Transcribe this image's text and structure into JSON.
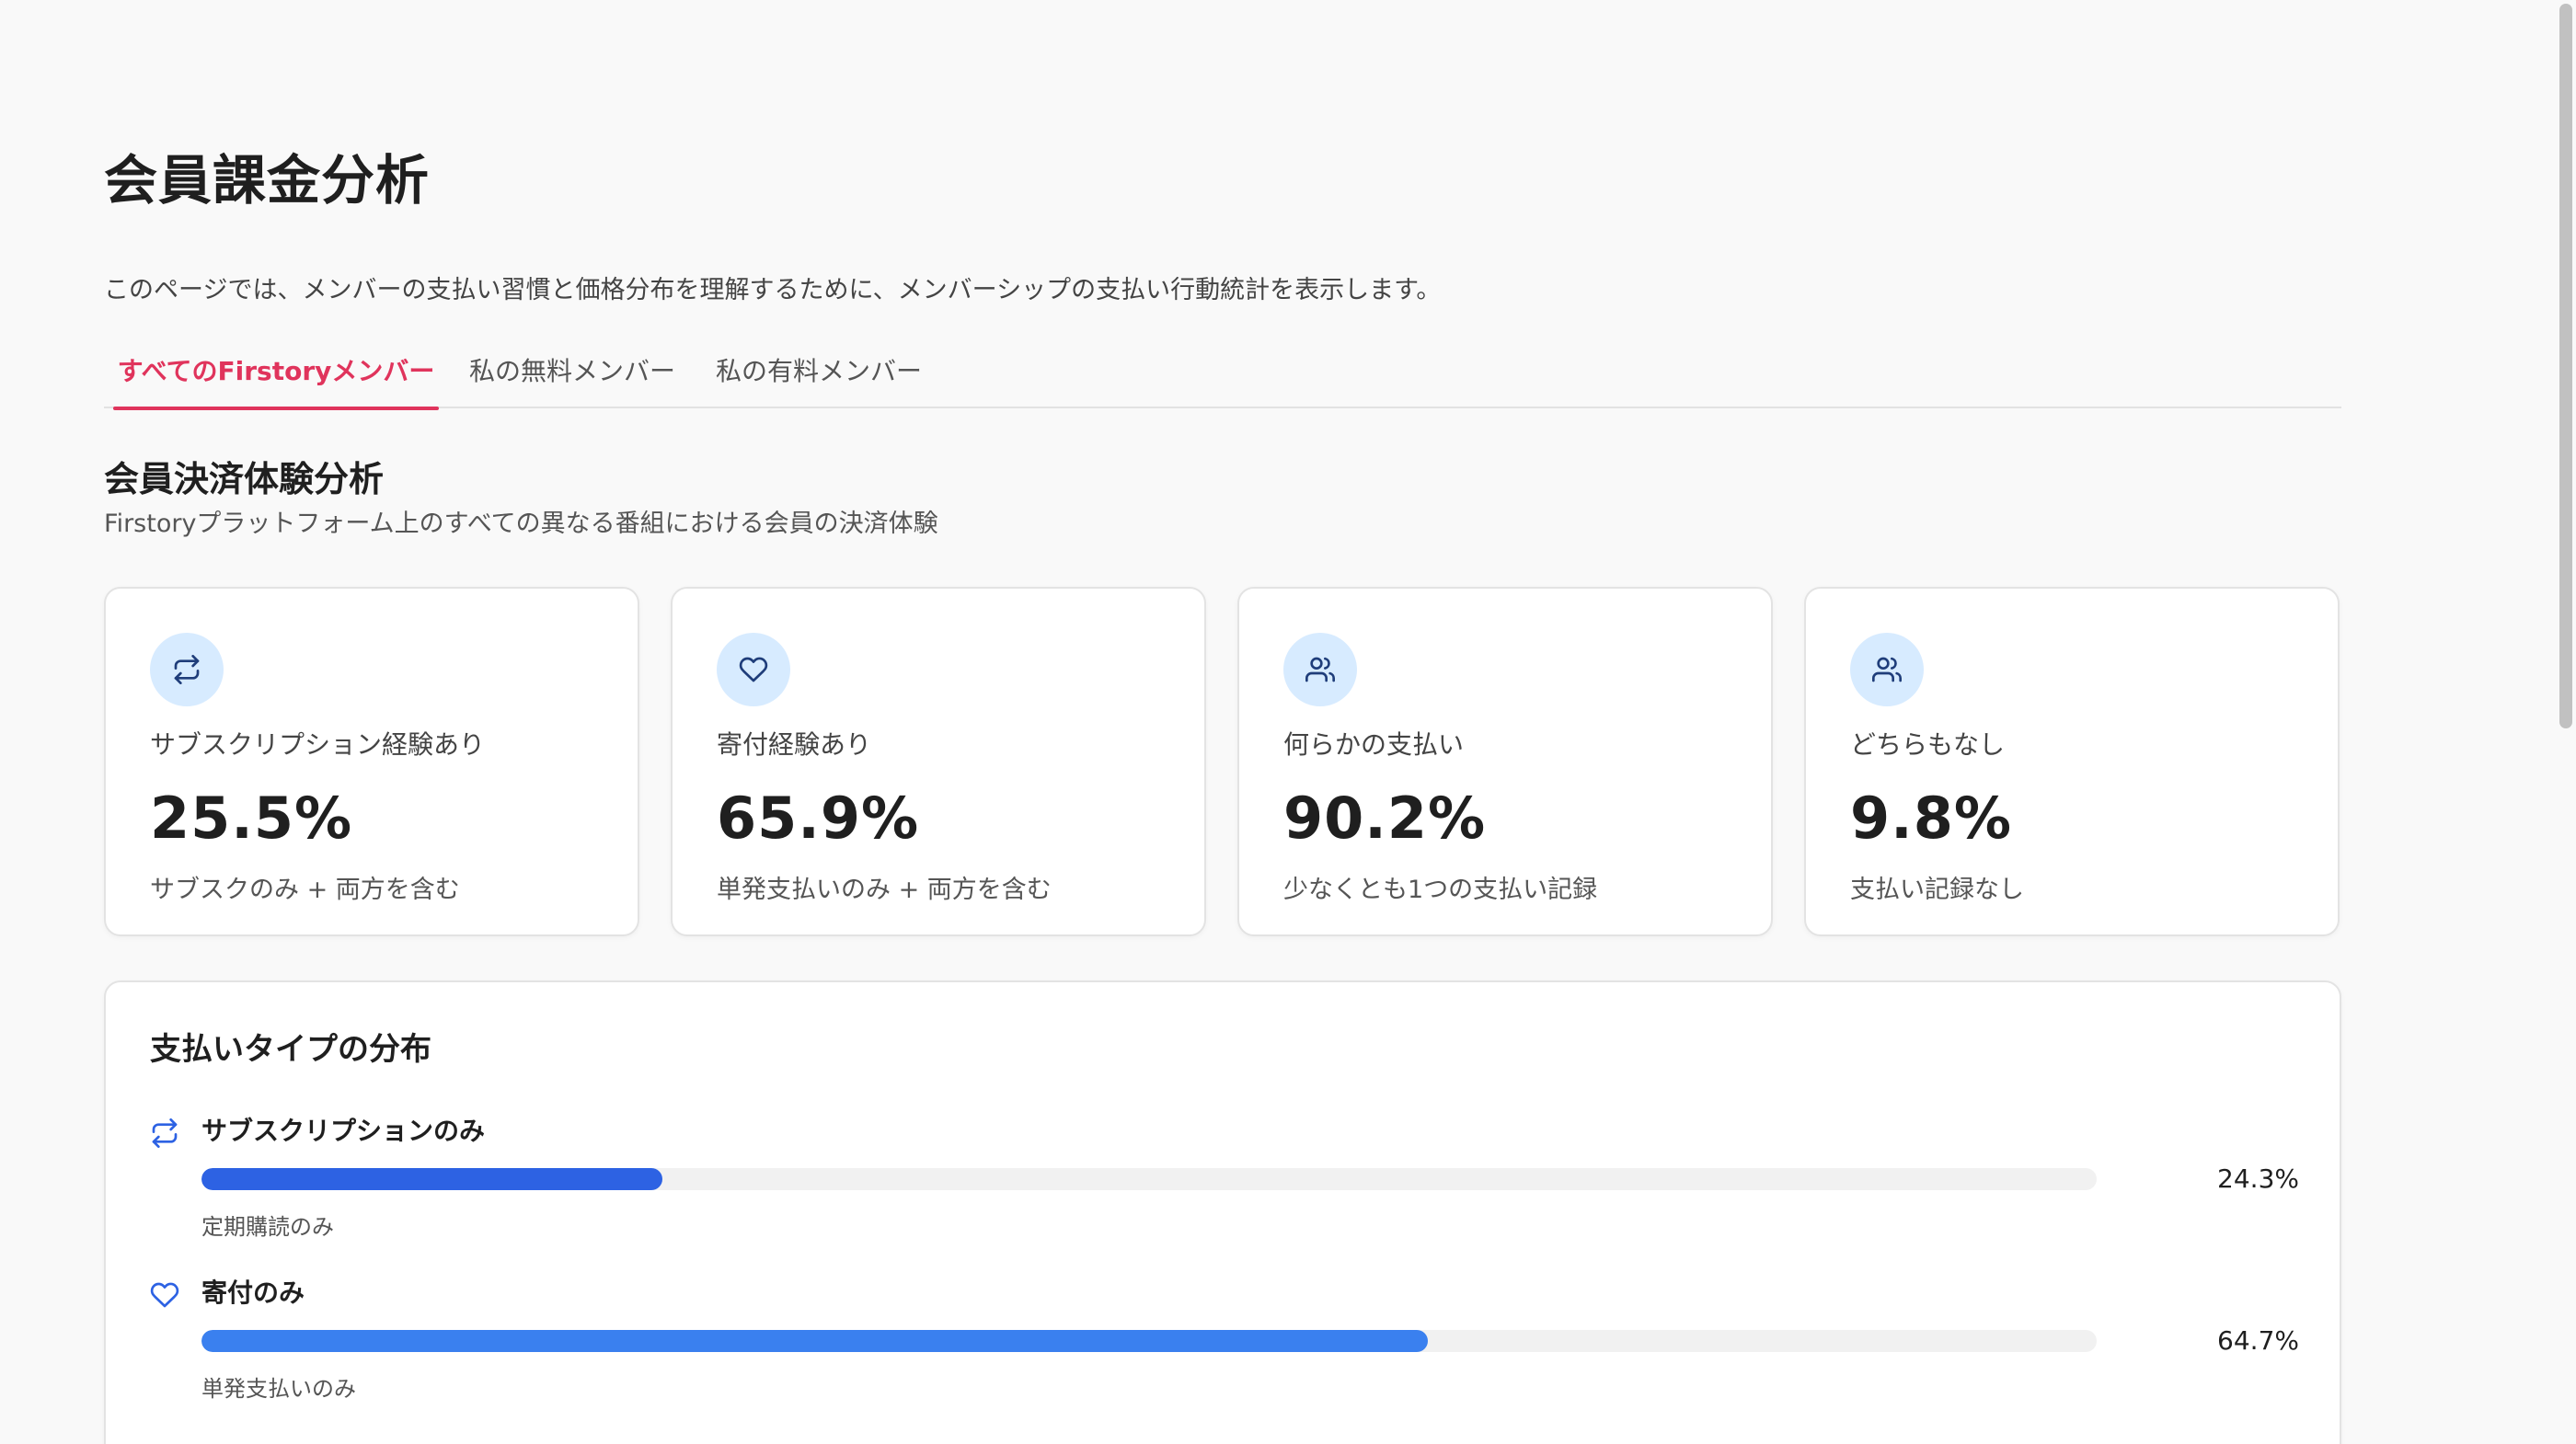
{
  "page": {
    "title": "会員課金分析",
    "description": "このページでは、メンバーの支払い習慣と価格分布を理解するために、メンバーシップの支払い行動統計を表示します。"
  },
  "tabs": [
    {
      "label": "すべてのFirstoryメンバー",
      "active": true
    },
    {
      "label": "私の無料メンバー",
      "active": false
    },
    {
      "label": "私の有料メンバー",
      "active": false
    }
  ],
  "section": {
    "title": "会員決済体験分析",
    "subtitle": "Firstoryプラットフォーム上のすべての異なる番組における会員の決済体験"
  },
  "cards": [
    {
      "icon": "repeat-icon",
      "label": "サブスクリプション経験あり",
      "value": "25.5%",
      "note": "サブスクのみ + 両方を含む"
    },
    {
      "icon": "heart-icon",
      "label": "寄付経験あり",
      "value": "65.9%",
      "note": "単発支払いのみ + 両方を含む"
    },
    {
      "icon": "users-icon",
      "label": "何らかの支払い",
      "value": "90.2%",
      "note": "少なくとも1つの支払い記録"
    },
    {
      "icon": "users-icon",
      "label": "どちらもなし",
      "value": "9.8%",
      "note": "支払い記録なし"
    }
  ],
  "distribution": {
    "title": "支払いタイプの分布",
    "items": [
      {
        "icon": "repeat-icon",
        "label": "サブスクリプションのみ",
        "percent": 24.3,
        "value_label": "24.3%",
        "note": "定期購読のみ",
        "color": "#2d62e3"
      },
      {
        "icon": "heart-icon",
        "label": "寄付のみ",
        "percent": 64.7,
        "value_label": "64.7%",
        "note": "単発支払いのみ",
        "color": "#3a80ef"
      }
    ]
  },
  "colors": {
    "accent": "#e0345c",
    "icon_bg": "#d7ebff",
    "icon_stroke": "#1f3d7a",
    "bar_track": "#f1f1f1"
  }
}
